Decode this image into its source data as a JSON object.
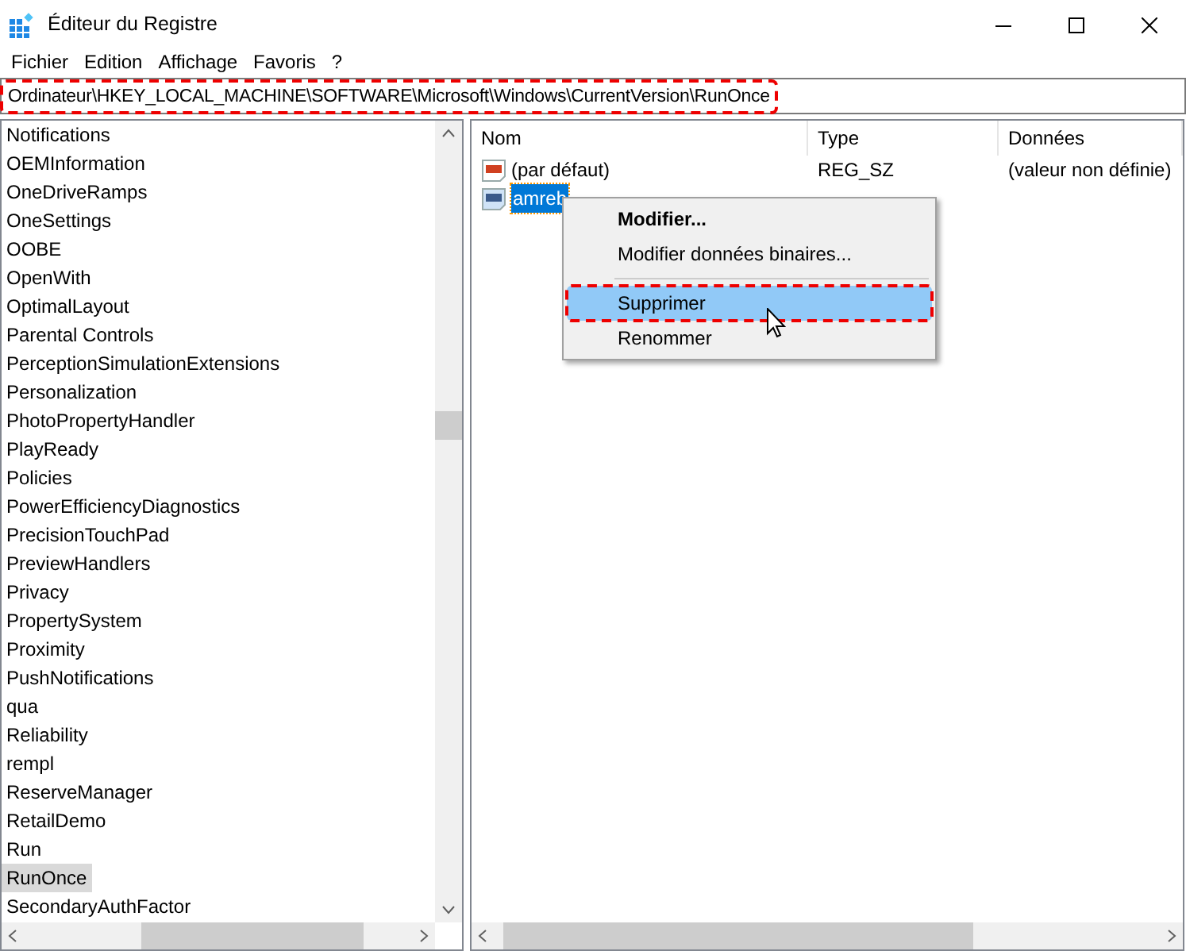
{
  "window": {
    "title": "Éditeur du Registre"
  },
  "menu_bar": [
    "Fichier",
    "Edition",
    "Affichage",
    "Favoris",
    "?"
  ],
  "address_bar": {
    "value": "Ordinateur\\HKEY_LOCAL_MACHINE\\SOFTWARE\\Microsoft\\Windows\\CurrentVersion\\RunOnce",
    "highlighted": true
  },
  "tree": {
    "items": [
      {
        "label": "Notifications",
        "selected": false
      },
      {
        "label": "OEMInformation",
        "selected": false
      },
      {
        "label": "OneDriveRamps",
        "selected": false
      },
      {
        "label": "OneSettings",
        "selected": false
      },
      {
        "label": "OOBE",
        "selected": false
      },
      {
        "label": "OpenWith",
        "selected": false
      },
      {
        "label": "OptimalLayout",
        "selected": false
      },
      {
        "label": "Parental Controls",
        "selected": false
      },
      {
        "label": "PerceptionSimulationExtensions",
        "selected": false
      },
      {
        "label": "Personalization",
        "selected": false
      },
      {
        "label": "PhotoPropertyHandler",
        "selected": false
      },
      {
        "label": "PlayReady",
        "selected": false
      },
      {
        "label": "Policies",
        "selected": false
      },
      {
        "label": "PowerEfficiencyDiagnostics",
        "selected": false
      },
      {
        "label": "PrecisionTouchPad",
        "selected": false
      },
      {
        "label": "PreviewHandlers",
        "selected": false
      },
      {
        "label": "Privacy",
        "selected": false
      },
      {
        "label": "PropertySystem",
        "selected": false
      },
      {
        "label": "Proximity",
        "selected": false
      },
      {
        "label": "PushNotifications",
        "selected": false
      },
      {
        "label": "qua",
        "selected": false
      },
      {
        "label": "Reliability",
        "selected": false
      },
      {
        "label": "rempl",
        "selected": false
      },
      {
        "label": "ReserveManager",
        "selected": false
      },
      {
        "label": "RetailDemo",
        "selected": false
      },
      {
        "label": "Run",
        "selected": false
      },
      {
        "label": "RunOnce",
        "selected": true
      },
      {
        "label": "SecondaryAuthFactor",
        "selected": false
      }
    ]
  },
  "values_table": {
    "columns": [
      "Nom",
      "Type",
      "Données"
    ],
    "rows": [
      {
        "name": "(par défaut)",
        "type": "REG_SZ",
        "data": "(valeur non définie)",
        "selected": false
      },
      {
        "name": "amreb",
        "selected": true
      }
    ]
  },
  "context_menu": {
    "items": [
      {
        "kind": "item",
        "label": "Modifier...",
        "bold": true,
        "hovered": false,
        "highlighted": false
      },
      {
        "kind": "item",
        "label": "Modifier données binaires...",
        "bold": false,
        "hovered": false,
        "highlighted": false
      },
      {
        "kind": "separator"
      },
      {
        "kind": "item",
        "label": "Supprimer",
        "bold": false,
        "hovered": true,
        "highlighted": true
      },
      {
        "kind": "item",
        "label": "Renommer",
        "bold": false,
        "hovered": false,
        "highlighted": false
      }
    ]
  }
}
